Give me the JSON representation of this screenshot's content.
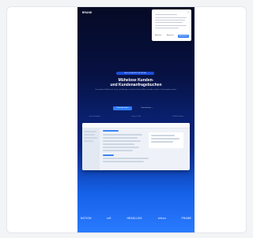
{
  "header": {
    "logo": "BRAND"
  },
  "cookie_banner": {
    "close_label": "×",
    "reject_label": "Ablehnen",
    "settings_label": "Anpassen",
    "accept_label": "Akzeptieren"
  },
  "hero": {
    "badge": "NEU: KI-GESTÜTZTE SUCHE",
    "title_line1": "Mühelose Kunden-",
    "title_line2": "und Kundenanfragebuchen",
    "subtitle": "Die moderne Plattform für Teams, die Anfragen schnell und übersichtlich verwalten möchten. Jetzt kostenlos starten.",
    "primary_cta": "Kostenlos testen",
    "secondary_cta": "Demo buchen →",
    "features": [
      "• Keine Kreditkarte",
      "• Setup in 2 Min.",
      "• DSGVO-konform"
    ]
  },
  "logos": [
    "NOTION",
    "mE",
    "HEADLUCK",
    "zilson",
    "FRAME"
  ]
}
